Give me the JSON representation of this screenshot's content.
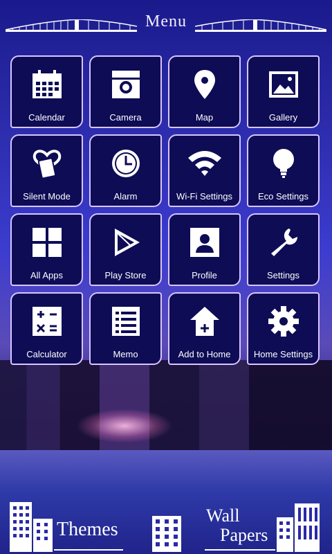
{
  "header": {
    "title": "Menu"
  },
  "tiles": [
    {
      "label": "Calendar",
      "icon": "calendar-icon"
    },
    {
      "label": "Camera",
      "icon": "camera-icon"
    },
    {
      "label": "Map",
      "icon": "map-pin-icon"
    },
    {
      "label": "Gallery",
      "icon": "gallery-icon"
    },
    {
      "label": "Silent Mode",
      "icon": "silent-mode-icon"
    },
    {
      "label": "Alarm",
      "icon": "clock-icon"
    },
    {
      "label": "Wi-Fi Settings",
      "icon": "wifi-icon"
    },
    {
      "label": "Eco Settings",
      "icon": "bulb-icon"
    },
    {
      "label": "All Apps",
      "icon": "grid-icon"
    },
    {
      "label": "Play Store",
      "icon": "play-icon"
    },
    {
      "label": "Profile",
      "icon": "profile-icon"
    },
    {
      "label": "Settings",
      "icon": "wrench-icon"
    },
    {
      "label": "Calculator",
      "icon": "calculator-icon"
    },
    {
      "label": "Memo",
      "icon": "memo-icon"
    },
    {
      "label": "Add to Home",
      "icon": "house-add-icon"
    },
    {
      "label": "Home Settings",
      "icon": "gear-icon"
    }
  ],
  "footer": {
    "themes_label": "Themes",
    "wall_label_1": "Wall",
    "wall_label_2": "Papers"
  },
  "colors": {
    "tile_bg": "#0e0c55",
    "tile_border": "#d8c6ff",
    "text": "#ffffff"
  }
}
